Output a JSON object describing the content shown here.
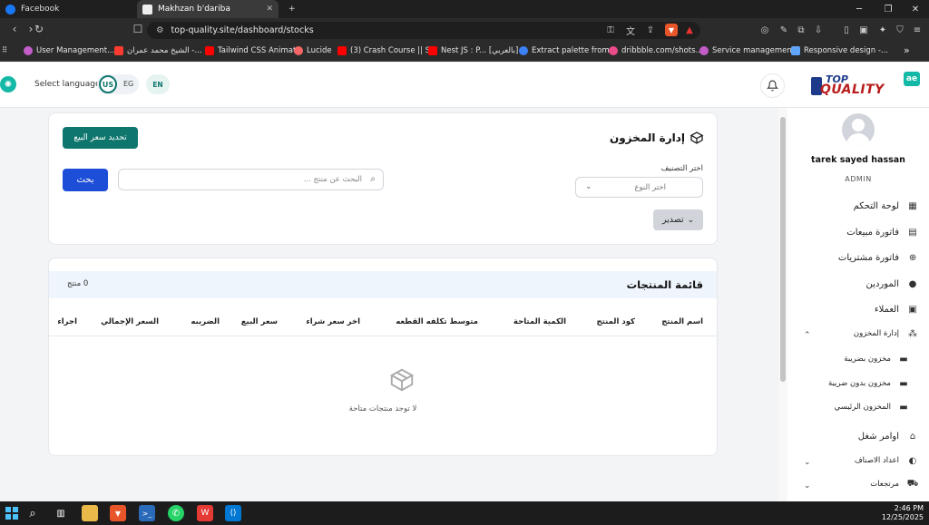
{
  "browser": {
    "tabs": [
      {
        "title": "Facebook",
        "active": false
      },
      {
        "title": "Makhzan b'dariba",
        "active": true
      }
    ],
    "new_tab": "+",
    "url": "top-quality.site/dashboard/stocks",
    "bookmarks": [
      "User Management...",
      "الشيخ محمد عمران -...",
      "Tailwind CSS Animat...",
      "Lucide",
      "(3) Crash Course || S...",
      "Nest JS : P... [بالعربي]",
      "Extract palette from...",
      "dribbble.com/shots...",
      "Service managemen...",
      "Responsive design -..."
    ],
    "more_bookmarks": "»"
  },
  "header": {
    "select_language": "Select language",
    "lang_us": "US",
    "lang_eg": "EG",
    "lang_en": "EN",
    "brand_top": "TOP",
    "brand_main": "QUALITY",
    "brand_badge": "ae"
  },
  "stock": {
    "title": "إدارة المخزون",
    "update_price_button": "تحديد سعر البيع",
    "search_button": "بحث",
    "search_placeholder": "البحث عن منتج ...",
    "filter_label": "اختر التصنيف",
    "filter_value": "اختر النوع",
    "export_button": "تصدير"
  },
  "products": {
    "title": "قائمة المنتجات",
    "count": "0 منتج",
    "columns": [
      "اسم المنتج",
      "كود المنتج",
      "الكمية المتاحة",
      "متوسط تكلفه القطعه",
      "اخر سعر شراء",
      "سعر البيع",
      "الضريبه",
      "السعر الإجمالي",
      "اجراء"
    ],
    "empty_message": "لا توجد منتجات متاحة"
  },
  "sidebar": {
    "user_name": "tarek sayed hassan",
    "user_role": "ADMIN",
    "items": [
      {
        "label": "لوحة التحكم",
        "icon": "dashboard-icon"
      },
      {
        "label": "فاتورة مبيعات",
        "icon": "invoice-icon"
      },
      {
        "label": "فاتورة مشتريات",
        "icon": "plus-circle-icon"
      },
      {
        "label": "الموردين",
        "icon": "user-icon"
      },
      {
        "label": "العملاء",
        "icon": "id-card-icon"
      },
      {
        "label": "إدارة المخزون",
        "icon": "boxes-icon"
      },
      {
        "label": "مخزون بضريبة",
        "icon": "archive-icon"
      },
      {
        "label": "مخزون بدون ضريبة",
        "icon": "archive-icon"
      },
      {
        "label": "المخزون الرئيسي",
        "icon": "archive-icon"
      },
      {
        "label": "اوامر شغل",
        "icon": "factory-icon"
      },
      {
        "label": "اعداد الاصناف",
        "icon": "category-icon"
      },
      {
        "label": "مرتجعات",
        "icon": "truck-icon"
      }
    ]
  },
  "taskbar": {
    "time": "2:46 PM",
    "date": "12/25/2025"
  },
  "colors": {
    "accent_teal": "#0f766e",
    "primary_blue": "#1d4ed8",
    "list_header_bg": "#eef5fc"
  }
}
